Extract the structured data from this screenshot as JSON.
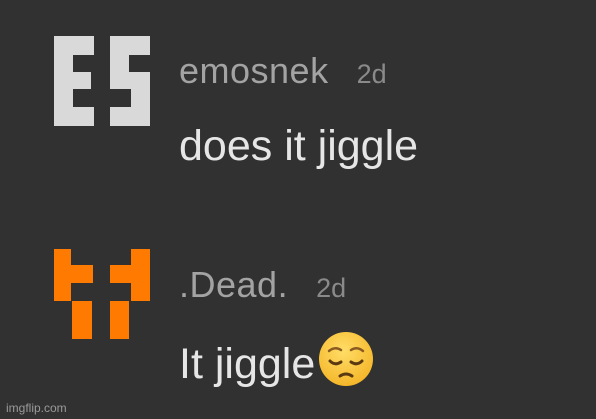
{
  "comments": [
    {
      "avatar_icon": "es-pixel-logo-icon",
      "avatar_color": "#d9d9d9",
      "username": "emosnek",
      "time": "2d",
      "text": "does it jiggle",
      "emoji": ""
    },
    {
      "avatar_icon": "orange-pixel-face-icon",
      "avatar_color": "#ff7a00",
      "username": ".Dead.",
      "time": "2d",
      "text": "It jiggle",
      "emoji": "pensive-face-emoji"
    }
  ],
  "watermark": "imgflip.com",
  "colors": {
    "background": "#313131",
    "username": "#a3a3a3",
    "time": "#8a8a8a",
    "message": "#e6e6e6"
  }
}
